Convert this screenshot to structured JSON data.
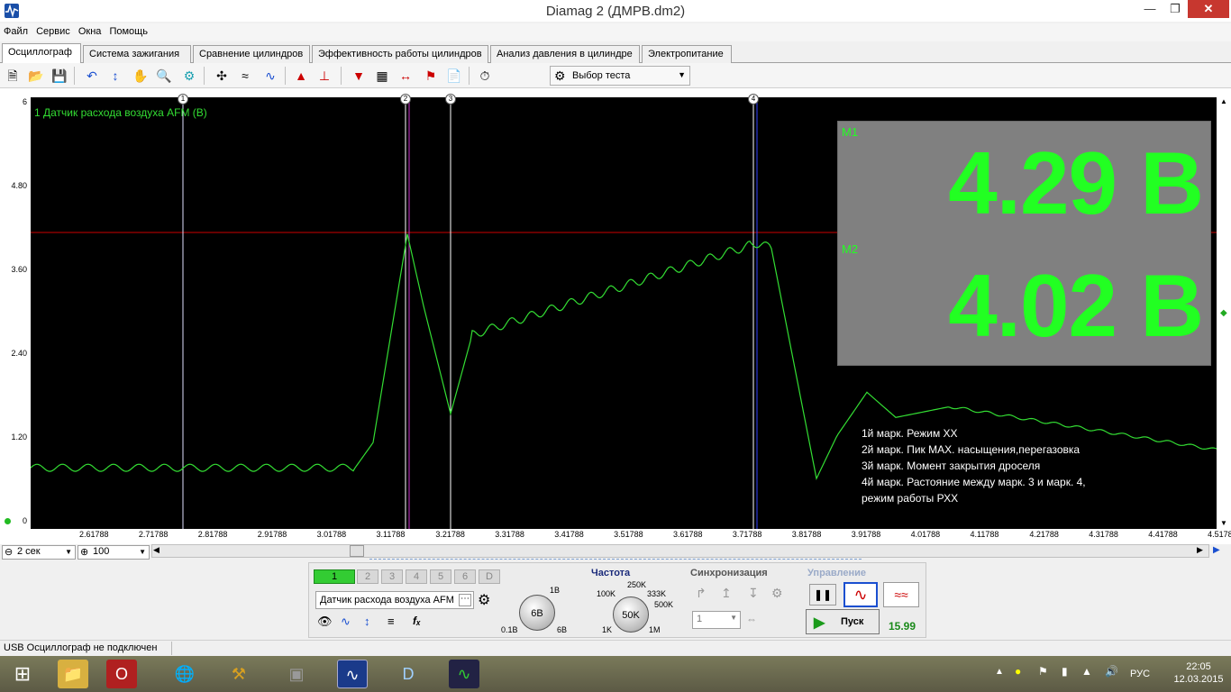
{
  "window": {
    "title": "Diamag 2 (ДМРВ.dm2)"
  },
  "menu": [
    "Файл",
    "Сервис",
    "Окна",
    "Помощь"
  ],
  "tabs": [
    "Осциллограф",
    "Система зажигания",
    "Сравнение цилиндров",
    "Эффективность работы цилиндров",
    "Анализ давления в цилиндре",
    "Электропитание"
  ],
  "toolbar": {
    "test_select": "Выбор теста"
  },
  "scope": {
    "channel_label": "1 Датчик расхода воздуха AFM (В)",
    "y_ticks": [
      "6",
      "4.80",
      "3.60",
      "2.40",
      "1.20",
      "0"
    ],
    "x_ticks": [
      "2.61788",
      "2.71788",
      "2.81788",
      "2.91788",
      "3.01788",
      "3.11788",
      "3.21788",
      "3.31788",
      "3.41788",
      "3.51788",
      "3.61788",
      "3.71788",
      "3.81788",
      "3.91788",
      "4.01788",
      "4.11788",
      "4.21788",
      "4.31788",
      "4.41788",
      "4.5178"
    ],
    "markers": [
      "1",
      "2",
      "3",
      "4"
    ],
    "readout": {
      "m1_tag": "M1",
      "m1_value": "4.29 В",
      "m2_tag": "M2",
      "m2_value": "4.02 В"
    },
    "notes": [
      "1й марк. Режим ХХ",
      "2й марк. Пик МАХ. насыщения,перегазовка",
      "3й марк. Момент закрытия дроселя",
      "4й марк. Растояние между марк. 3 и марк. 4,",
      "режим работы РХХ"
    ],
    "colors": {
      "trace": "#33dd33",
      "background": "#000000",
      "h_cursor": "#cc0000"
    }
  },
  "bottom": {
    "timebase": "2 сек",
    "zoom": "100"
  },
  "control": {
    "channels": [
      "1",
      "2",
      "3",
      "4",
      "5",
      "6",
      "D"
    ],
    "sensor": "Датчик расхода воздуха AFM",
    "volt_knob": {
      "value": "6В",
      "min": "0.1В",
      "mid": "1В",
      "max": "6В"
    },
    "freq": {
      "title": "Частота",
      "value": "50K",
      "labels": [
        "100K",
        "250K",
        "333K",
        "500K",
        "1K",
        "1M"
      ]
    },
    "sync": {
      "title": "Синхронизация",
      "value": "1"
    },
    "manage": {
      "title": "Управление",
      "start": "Пуск",
      "counter": "15.99"
    }
  },
  "status": {
    "text": "USB Осциллограф не подключен"
  },
  "taskbar": {
    "lang": "РУС",
    "time": "22:05",
    "date": "12.03.2015"
  }
}
